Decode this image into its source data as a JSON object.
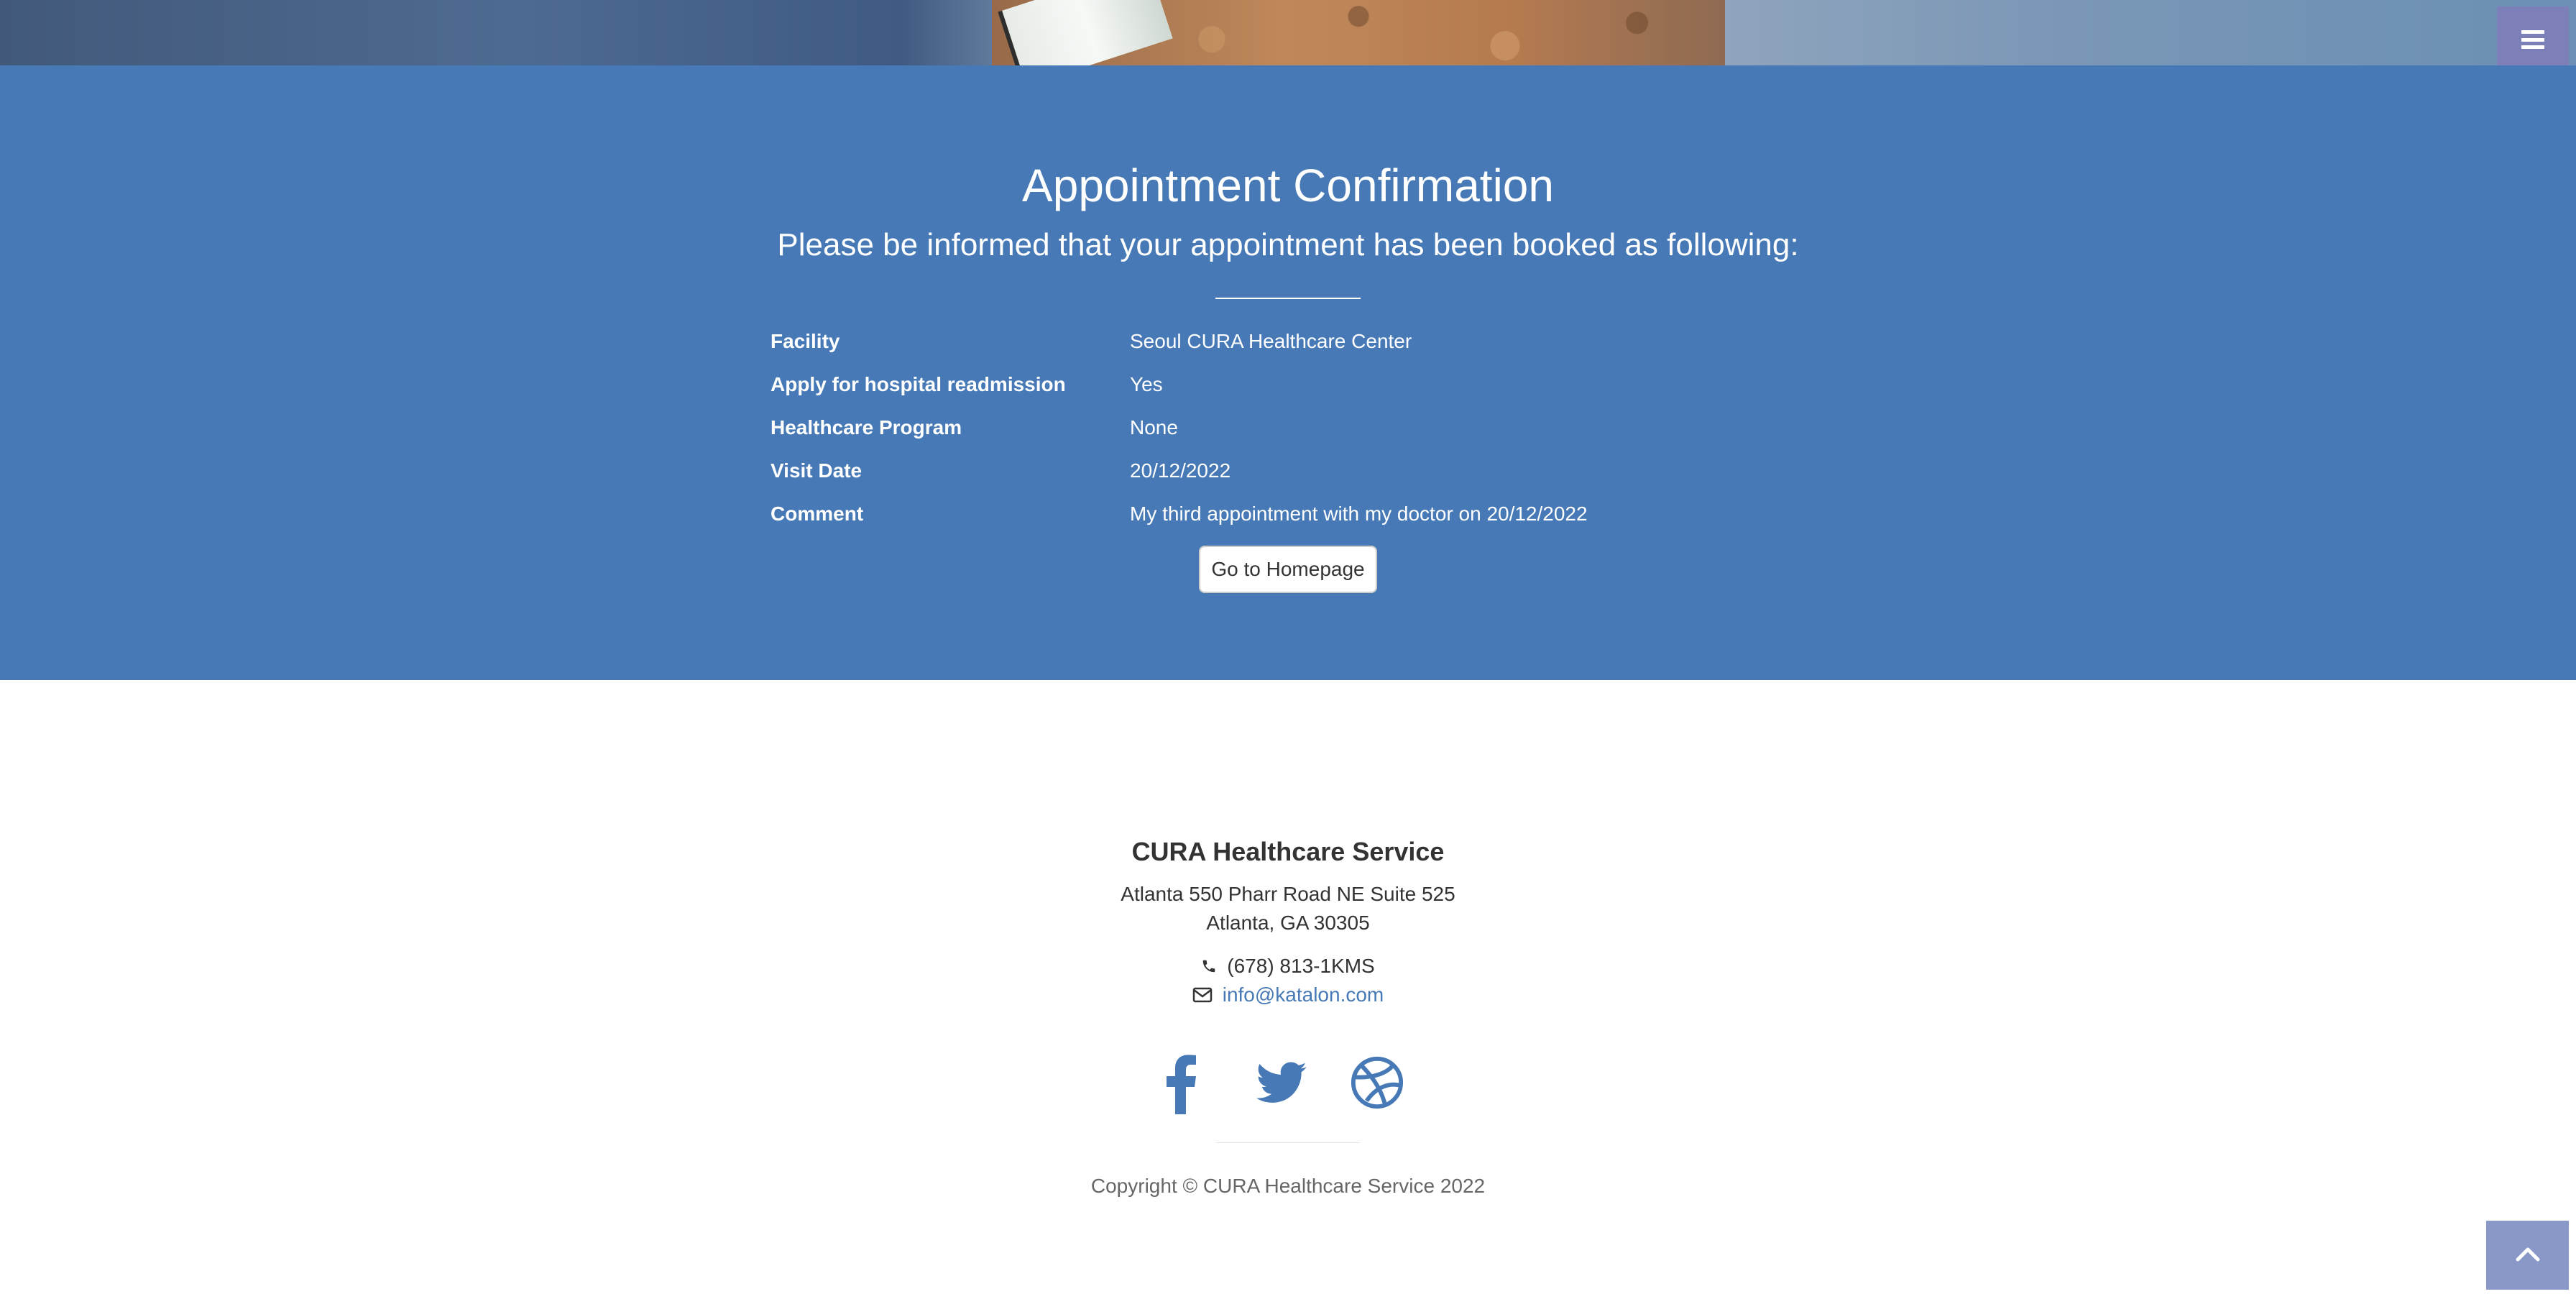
{
  "hero": {
    "image": "photo-strip"
  },
  "menu": {
    "icon": "bars-icon"
  },
  "appointment": {
    "title": "Appointment Confirmation",
    "subtitle": "Please be informed that your appointment has been booked as following:",
    "details": [
      {
        "label": "Facility",
        "value": "Seoul CURA Healthcare Center"
      },
      {
        "label": "Apply for hospital readmission",
        "value": "Yes"
      },
      {
        "label": "Healthcare Program",
        "value": "None"
      },
      {
        "label": "Visit Date",
        "value": "20/12/2022"
      },
      {
        "label": "Comment",
        "value": "My third appointment with my doctor on 20/12/2022"
      }
    ],
    "button_label": "Go to Homepage"
  },
  "footer": {
    "title": "CURA Healthcare Service",
    "address_line1": "Atlanta 550 Pharr Road NE Suite 525",
    "address_line2": "Atlanta, GA 30305",
    "phone": "(678) 813-1KMS",
    "email": "info@katalon.com",
    "social": [
      "facebook-icon",
      "twitter-icon",
      "dribbble-icon"
    ],
    "copyright": "Copyright © CURA Healthcare Service 2022"
  },
  "colors": {
    "section_blue": "#4679b5",
    "menu_button": "#7c7fb8",
    "to_top_button": "#8a98c8"
  }
}
